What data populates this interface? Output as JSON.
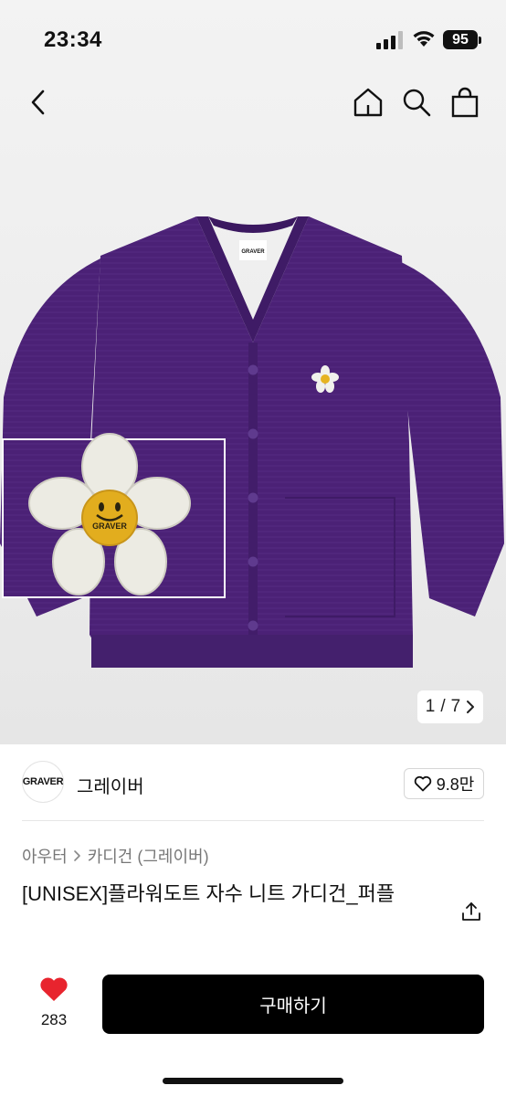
{
  "status_bar": {
    "time": "23:34",
    "battery": "95",
    "icons": [
      "cellular-signal-icon",
      "wifi-icon",
      "battery-icon"
    ]
  },
  "nav": {
    "icons": [
      "back-chevron-icon",
      "home-icon",
      "search-icon",
      "shopping-bag-icon"
    ]
  },
  "gallery": {
    "current": "1",
    "total": "7",
    "separator": "/",
    "product_color": "#4b2176",
    "label_text": "GRAVER"
  },
  "brand": {
    "logo_text": "GRAVER",
    "name": "그레이버",
    "likes": "9.8만"
  },
  "breadcrumb": [
    {
      "label": "아우터"
    },
    {
      "label": "카디건 (그레이버)"
    }
  ],
  "product": {
    "title": "[UNISEX]플라워도트 자수 니트 가디건_퍼플"
  },
  "bottom_bar": {
    "like_count": "283",
    "like_color": "#e8242e",
    "buy_label": "구매하기"
  }
}
